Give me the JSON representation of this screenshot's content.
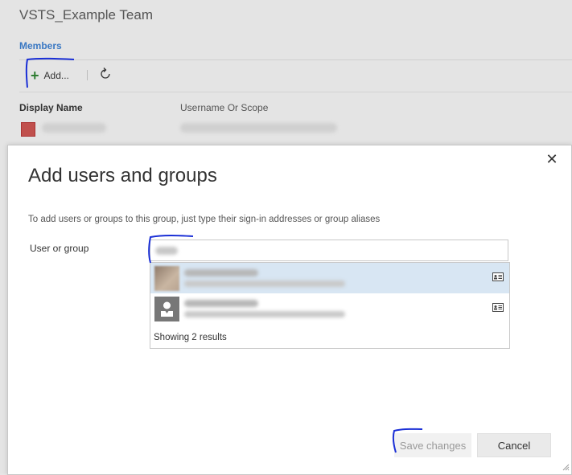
{
  "team": {
    "title": "VSTS_Example Team"
  },
  "tabs": {
    "members": "Members"
  },
  "toolbar": {
    "add_label": "Add...",
    "refresh_icon": "refresh-icon"
  },
  "members_table": {
    "columns": [
      "Display Name",
      "Username Or Scope"
    ]
  },
  "dialog": {
    "title": "Add users and groups",
    "description": "To add users or groups to this group, just type their sign-in addresses or group aliases",
    "field_label": "User or group",
    "results_summary": "Showing 2 results",
    "save_label": "Save changes",
    "cancel_label": "Cancel",
    "close_icon": "close-icon"
  },
  "colors": {
    "accent": "#3a78c3",
    "add_icon": "#2e7d32",
    "selected_row": "#d8e6f3",
    "annotation_ink": "#1a2fd6"
  }
}
